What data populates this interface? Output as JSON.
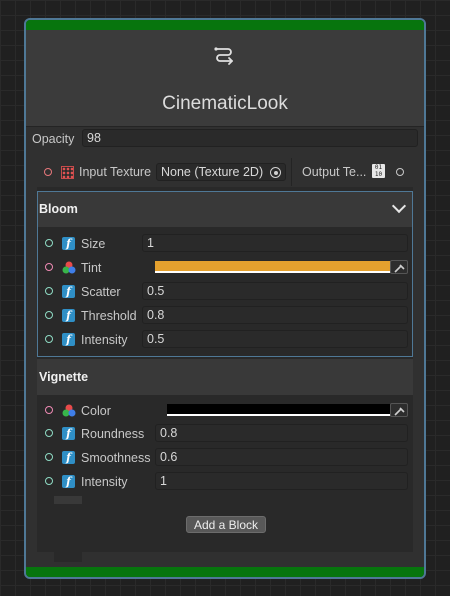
{
  "node": {
    "title": "CinematicLook",
    "icon": "shader-graph-icon"
  },
  "opacity": {
    "label": "Opacity",
    "value": "98"
  },
  "input_texture": {
    "label": "Input Texture",
    "value": "None (Texture 2D)"
  },
  "output_texture": {
    "label": "Output Te..."
  },
  "bloom": {
    "title": "Bloom",
    "size": {
      "label": "Size",
      "value": "1"
    },
    "tint": {
      "label": "Tint",
      "color": "#e5a12e"
    },
    "scatter": {
      "label": "Scatter",
      "value": "0.5"
    },
    "threshold": {
      "label": "Threshold",
      "value": "0.8"
    },
    "intensity": {
      "label": "Intensity",
      "value": "0.5"
    }
  },
  "vignette": {
    "title": "Vignette",
    "color": {
      "label": "Color",
      "color": "#000000"
    },
    "roundness": {
      "label": "Roundness",
      "value": "0.8"
    },
    "smoothness": {
      "label": "Smoothness",
      "value": "0.6"
    },
    "intensity": {
      "label": "Intensity",
      "value": "1"
    }
  },
  "add_block": {
    "label": "Add a Block"
  },
  "colors": {
    "accent": "#07750d",
    "selection": "#4f7896",
    "port_float": "#8fdbc4",
    "port_color": "#ee8ab4",
    "port_texture": "#e7777b"
  }
}
